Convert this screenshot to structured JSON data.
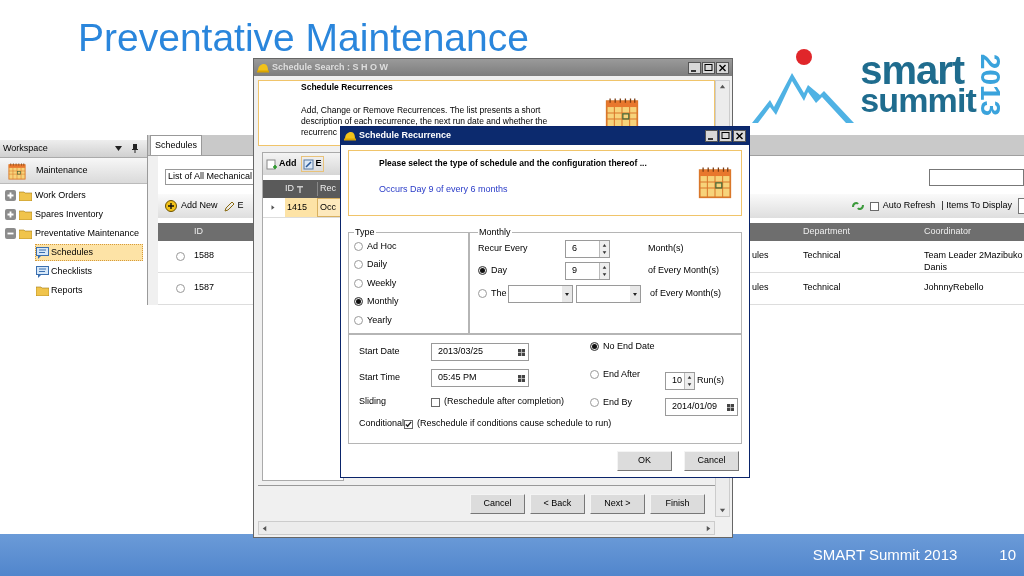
{
  "slide": {
    "title": "Preventative Maintenance",
    "footer_text": "SMART Summit 2013",
    "page_number": "10"
  },
  "logo": {
    "line_1": "smart",
    "line_2": "summit",
    "year": "2013"
  },
  "workspace": {
    "title": "Workspace",
    "module": "Maintenance",
    "tree": [
      {
        "label": "Work Orders",
        "expanded": false
      },
      {
        "label": "Spares Inventory",
        "expanded": false
      },
      {
        "label": "Preventative Maintenance",
        "expanded": true,
        "children": [
          {
            "label": "Schedules",
            "kind": "list",
            "selected": true
          },
          {
            "label": "Checklists",
            "kind": "list",
            "selected": false
          },
          {
            "label": "Reports",
            "kind": "folder",
            "selected": false
          }
        ]
      }
    ]
  },
  "schedules": {
    "tab": "Schedules",
    "view_select": "List of All Mechanical",
    "add_button": "Add New",
    "edit_button": "E",
    "auto_refresh": {
      "label": "Auto Refresh",
      "checked": false
    },
    "items_to_display": "| Items To Display",
    "columns": {
      "id": "ID",
      "department": "Department",
      "coordinator": "Coordinator"
    },
    "rows": [
      {
        "id": "1588",
        "column_3": "ules",
        "department": "Technical",
        "coordinator": "Team Leader 2Mazibuko Danis",
        "selected": false
      },
      {
        "id": "1587",
        "column_3": "ules",
        "department": "Technical",
        "coordinator": "JohnnyRebello",
        "selected": false
      }
    ]
  },
  "search_window": {
    "title": "Schedule Search : S H O W",
    "header_title": "Schedule Recurrences",
    "description_lines": [
      "Add, Change or Remove Recurrences. The list presents a short",
      "description of each recurrence, the next run date and whether the",
      "recurrenc"
    ],
    "add_button": "Add",
    "edit_button": "E",
    "columns": [
      "ID",
      "Rec"
    ],
    "rows": [
      {
        "id": "1415",
        "column_2": "Occ",
        "selected": true
      }
    ],
    "buttons": [
      "Cancel",
      "< Back",
      "Next >",
      "Finish"
    ]
  },
  "dialog": {
    "title": "Schedule Recurrence",
    "prompt": "Please select the type of schedule and the configuration thereof ...",
    "summary": "Occurs Day 9 of every 6 months",
    "type_group": {
      "label": "Type",
      "options": [
        {
          "label": "Ad Hoc",
          "selected": false
        },
        {
          "label": "Daily",
          "selected": false
        },
        {
          "label": "Weekly",
          "selected": false
        },
        {
          "label": "Monthly",
          "selected": true
        },
        {
          "label": "Yearly",
          "selected": false
        }
      ]
    },
    "monthly": {
      "label": "Monthly",
      "recur_every": {
        "label": "Recur Every",
        "value": "6",
        "unit": "Month(s)"
      },
      "day_option": {
        "label": "Day",
        "selected": true,
        "value": "9",
        "suffix": "of Every Month(s)"
      },
      "the_option": {
        "label": "The",
        "selected": false,
        "suffix": "of Every Month(s)"
      }
    },
    "start_date": {
      "label": "Start Date",
      "value": "2013/03/25"
    },
    "start_time": {
      "label": "Start Time",
      "value": "05:45 PM"
    },
    "sliding": {
      "label": "Sliding",
      "option": "(Reschedule after completion)",
      "checked": false
    },
    "conditional": {
      "label": "Conditional",
      "option": "(Reschedule if conditions cause schedule to run)",
      "checked": true
    },
    "end_options": [
      {
        "kind": "none",
        "label": "No End Date",
        "selected": true
      },
      {
        "kind": "count",
        "label": "End After",
        "selected": false,
        "value": "10",
        "unit": "Run(s)"
      },
      {
        "kind": "date",
        "label": "End By",
        "selected": false,
        "value": "2014/01/09"
      }
    ],
    "buttons": [
      "OK",
      "Cancel"
    ]
  }
}
